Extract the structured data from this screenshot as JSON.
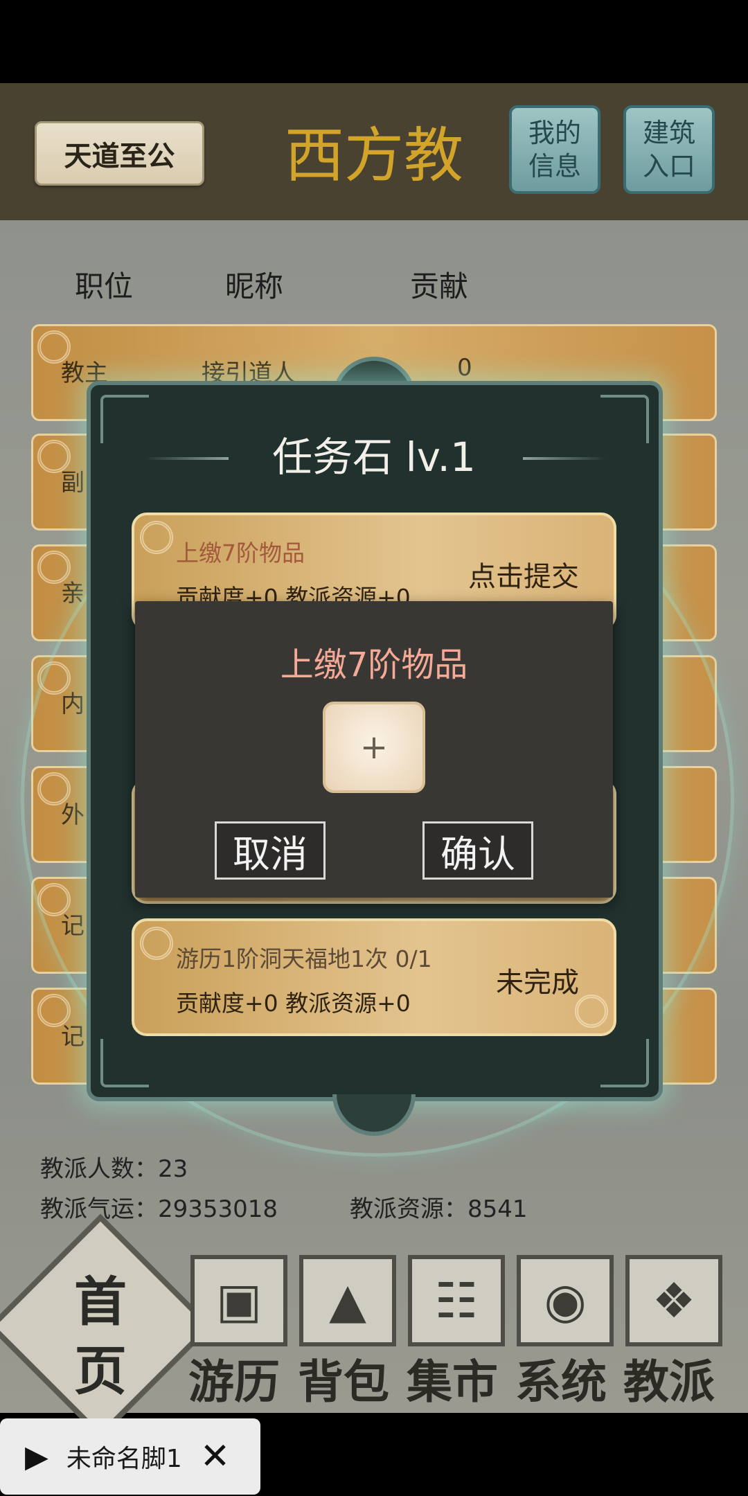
{
  "header": {
    "sign": "天道至公",
    "title": "西方教",
    "my_info": "我的信息",
    "building": "建筑入口"
  },
  "members": {
    "columns": [
      "职位",
      "昵称",
      "贡献"
    ],
    "rows": [
      {
        "rank": "教主",
        "name": "接引道人",
        "contrib": "0"
      },
      {
        "rank": "副",
        "name": "",
        "contrib": ""
      },
      {
        "rank": "亲",
        "name": "",
        "contrib": ""
      },
      {
        "rank": "内",
        "name": "",
        "contrib": ""
      },
      {
        "rank": "外",
        "name": "",
        "contrib": ""
      },
      {
        "rank": "记",
        "name": "",
        "contrib": ""
      },
      {
        "rank": "记",
        "name": "",
        "contrib": ""
      }
    ]
  },
  "task_panel": {
    "title": "任务石 lv.1",
    "tasks": [
      {
        "name": "上缴7阶物品",
        "reward": "贡献度+0 教派资源+0",
        "action": "点击提交"
      },
      {
        "name": "游历1阶洞天福地1次 0/1",
        "reward": "贡献度+0 教派资源+0",
        "action": "未完成"
      }
    ]
  },
  "dialog": {
    "title": "上缴7阶物品",
    "slot": "+",
    "cancel": "取消",
    "confirm": "确认"
  },
  "stats": {
    "members_label": "教派人数：",
    "members_value": "23",
    "luck_label": "教派气运：",
    "luck_value": "29353018",
    "resource_label": "教派资源：",
    "resource_value": "8541"
  },
  "nav": {
    "home": "首页",
    "items": [
      "游历",
      "背包",
      "集市",
      "系统",
      "教派"
    ]
  },
  "script_bar": {
    "name": "未命名脚1"
  },
  "colors": {
    "title_gold": "#d2a52a",
    "dialog_title": "#f5aa98",
    "header_bg": "#4a4231"
  }
}
